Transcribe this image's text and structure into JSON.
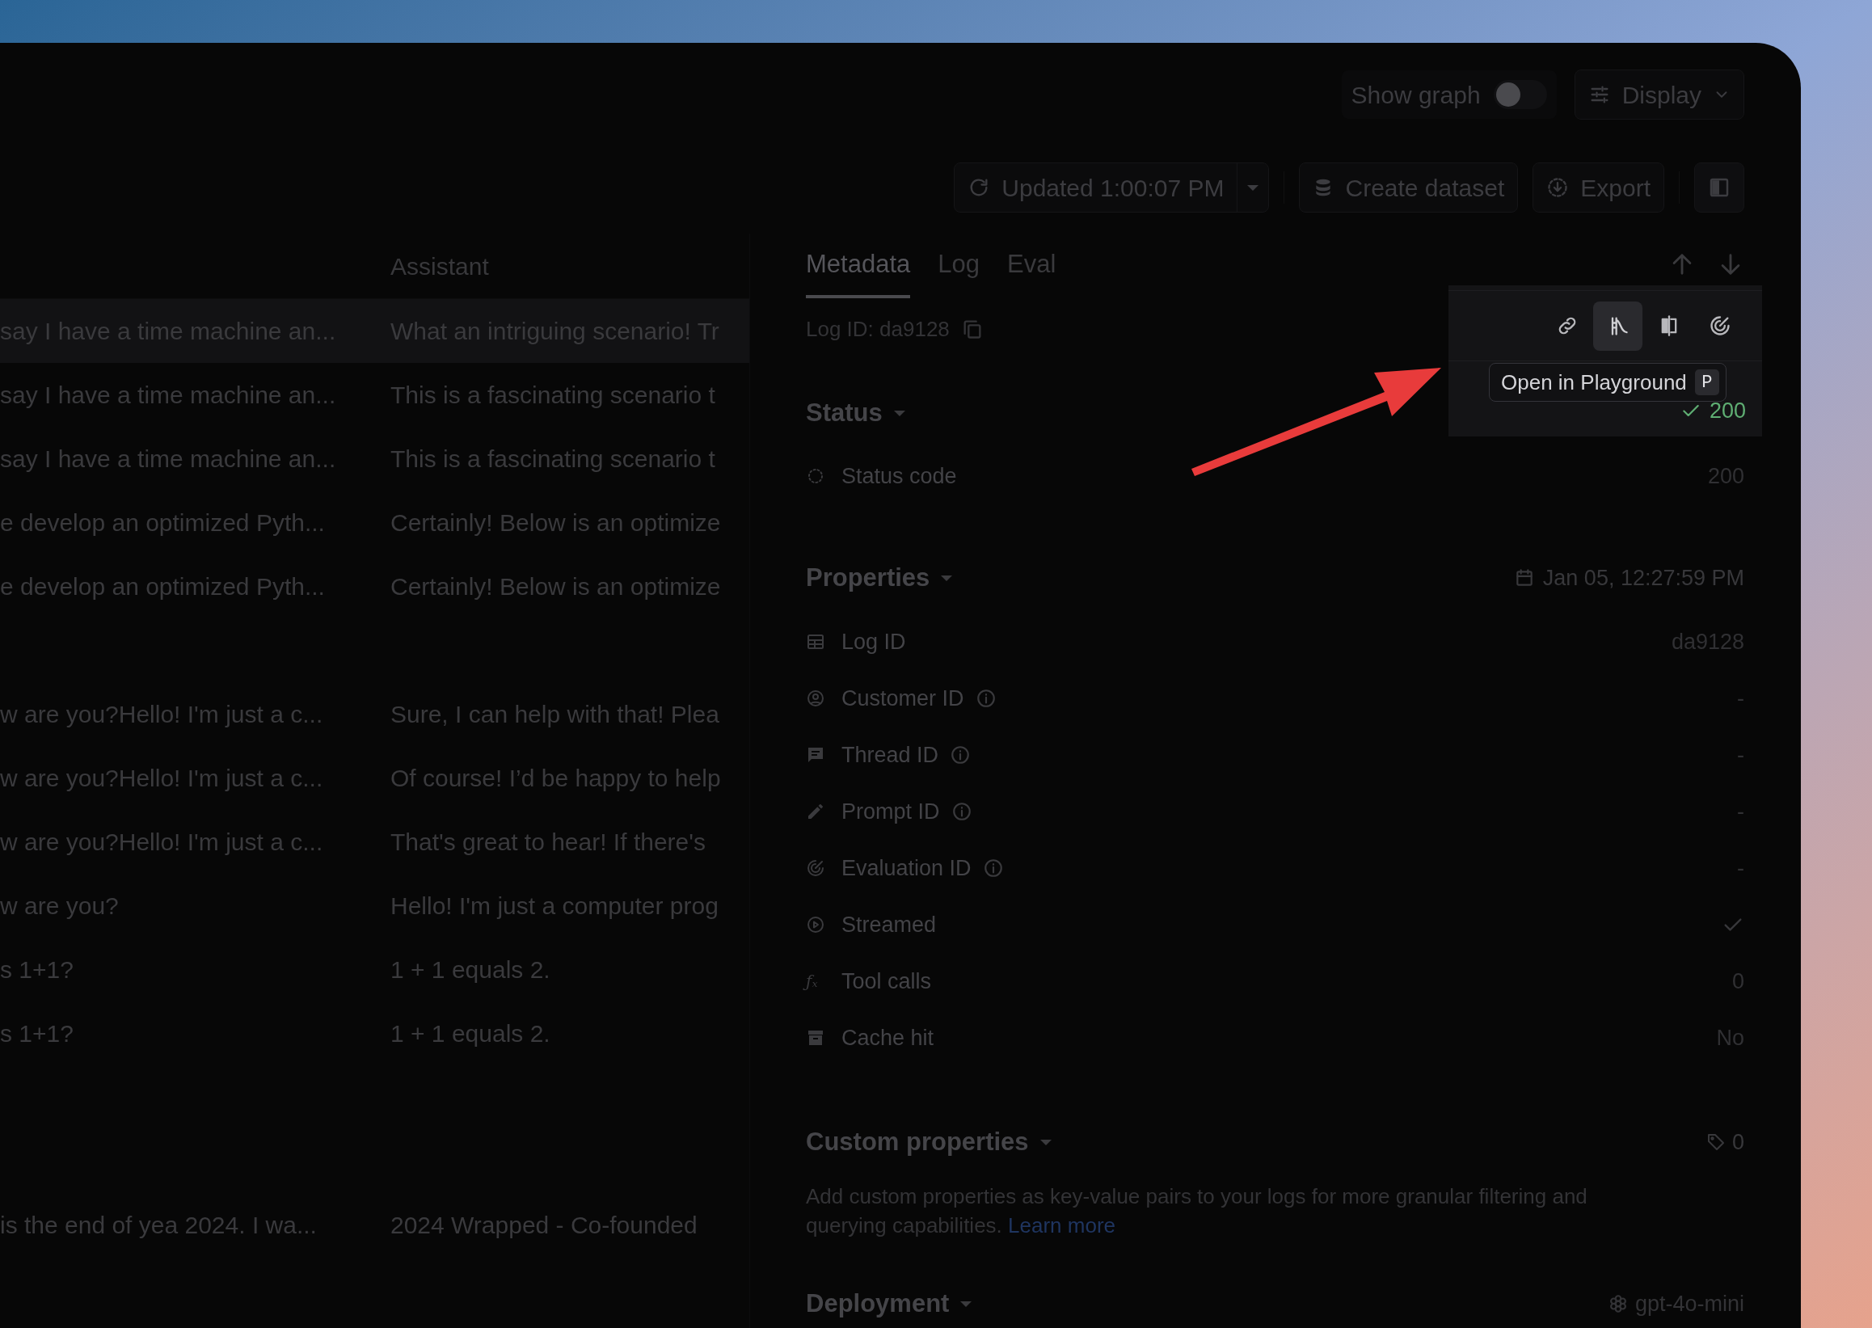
{
  "toolbar": {
    "show_graph": {
      "label": "Show graph",
      "on": false
    },
    "display_button": "Display",
    "updated_button": "Updated 1:00:07 PM",
    "create_dataset_button": "Create dataset",
    "export_button": "Export"
  },
  "table": {
    "assistant_header": "Assistant",
    "rows": [
      {
        "kind": "log",
        "column_1": "say I have a time machine an...",
        "assistant": "What an intriguing scenario! Tr",
        "selected": true
      },
      {
        "kind": "log",
        "column_1": "say I have a time machine an...",
        "assistant": "This is a fascinating scenario t",
        "selected": false
      },
      {
        "kind": "log",
        "column_1": "say I have a time machine an...",
        "assistant": "This is a fascinating scenario t",
        "selected": false
      },
      {
        "kind": "log",
        "column_1": "e develop an optimized Pyth...",
        "assistant": "Certainly! Below is an optimize",
        "selected": false
      },
      {
        "kind": "log",
        "column_1": "e develop an optimized Pyth...",
        "assistant": "Certainly! Below is an optimize",
        "selected": false
      },
      {
        "kind": "blank",
        "selected": false
      },
      {
        "kind": "log",
        "column_1": "w are you?Hello! I'm just a c...",
        "assistant": "Sure, I can help with that! Plea",
        "selected": false
      },
      {
        "kind": "log",
        "column_1": "w are you?Hello! I'm just a c...",
        "assistant": "Of course! I’d be happy to help",
        "selected": false
      },
      {
        "kind": "log",
        "column_1": "w are you?Hello! I'm just a c...",
        "assistant": "That's great to hear! If there's",
        "selected": false
      },
      {
        "kind": "log",
        "column_1": "w are you?",
        "assistant": "Hello! I'm just a computer prog",
        "selected": false
      },
      {
        "kind": "log",
        "column_1": "s 1+1?",
        "assistant": "1 + 1 equals 2.",
        "selected": false
      },
      {
        "kind": "log",
        "column_1": "s 1+1?",
        "assistant": "1 + 1 equals 2.",
        "selected": false
      },
      {
        "kind": "blank",
        "selected": false
      },
      {
        "kind": "blank",
        "selected": false
      },
      {
        "kind": "log",
        "column_1": "is the end of yea 2024. I wa...",
        "assistant": "2024 Wrapped - Co-founded",
        "selected": false
      }
    ]
  },
  "panel": {
    "tabs": [
      {
        "label": "Metadata",
        "selected": true
      },
      {
        "label": "Log",
        "selected": false
      },
      {
        "label": "Eval",
        "selected": false
      }
    ],
    "log_id": "Log ID: da9128",
    "actions": [
      {
        "kind": "link",
        "selected": false
      },
      {
        "kind": "playground",
        "selected": true
      },
      {
        "kind": "compare",
        "selected": false
      },
      {
        "kind": "evaluate",
        "selected": false
      }
    ],
    "tooltip": {
      "text": "Open in Playground",
      "shortcut": "P"
    },
    "status": {
      "title": "Status",
      "value": "200",
      "status_code_label": "Status code",
      "status_code": "200"
    },
    "properties": {
      "title": "Properties",
      "date": "Jan 05, 12:27:59 PM",
      "rows": [
        {
          "label": "Log ID",
          "info": false,
          "kind": "text",
          "value": "da9128"
        },
        {
          "label": "Customer ID",
          "info": true,
          "kind": "text",
          "value": "-"
        },
        {
          "label": "Thread ID",
          "info": true,
          "kind": "text",
          "value": "-"
        },
        {
          "label": "Prompt ID",
          "info": true,
          "kind": "text",
          "value": "-"
        },
        {
          "label": "Evaluation ID",
          "info": true,
          "kind": "text",
          "value": "-"
        },
        {
          "label": "Streamed",
          "info": false,
          "kind": "check",
          "checked": true
        },
        {
          "icon_text": "ƒₓ",
          "label": "Tool calls",
          "info": false,
          "kind": "text",
          "value": "0"
        },
        {
          "label": "Cache hit",
          "info": false,
          "kind": "text",
          "value": "No"
        }
      ]
    },
    "custom_properties": {
      "title": "Custom properties",
      "count": "0",
      "description": "Add custom properties as key-value pairs to your logs for more granular filtering and querying capabilities.",
      "link": "Learn more"
    },
    "deployment": {
      "title": "Deployment",
      "value": "gpt-4o-mini"
    }
  }
}
